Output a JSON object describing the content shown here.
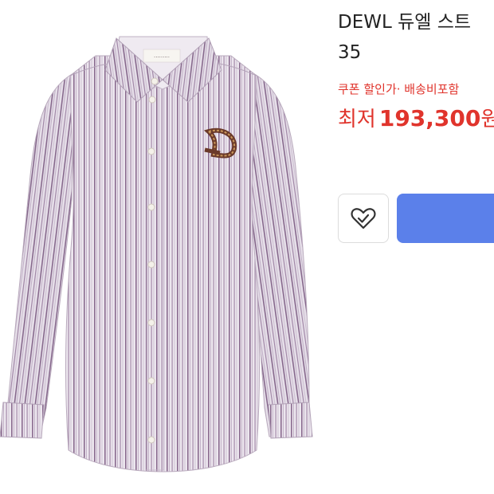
{
  "product": {
    "title_line1": "DEWL 듀엘 스트",
    "title_line2": "35",
    "coupon_text": "쿠폰 할인가· 배송비포함",
    "price_prefix": "최저",
    "price_value": "193,300",
    "price_unit": "원"
  },
  "actions": {
    "wishlist_icon": "heart-check-icon",
    "buy_button_color": "#5b80ea"
  },
  "colors": {
    "price": "#e0342c",
    "shirt_base": "#ece6ee",
    "stripe_dark": "#8a6b8f",
    "stripe_light": "#c3b2c8"
  }
}
